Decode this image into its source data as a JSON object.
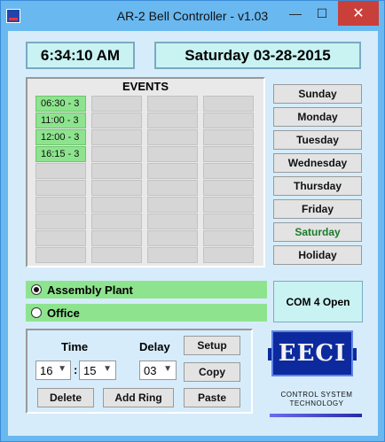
{
  "window": {
    "title": "AR-2 Bell Controller - v1.03",
    "minimize": "—",
    "maximize": "☐",
    "close": "✕"
  },
  "clock": {
    "time": "6:34:10 AM",
    "date": "Saturday 03-28-2015"
  },
  "events": {
    "label": "EVENTS",
    "columns": [
      [
        "06:30 - 3",
        "11:00 - 3",
        "12:00 - 3",
        "16:15 - 3",
        "",
        "",
        "",
        "",
        "",
        ""
      ],
      [
        "",
        "",
        "",
        "",
        "",
        "",
        "",
        "",
        "",
        ""
      ],
      [
        "",
        "",
        "",
        "",
        "",
        "",
        "",
        "",
        "",
        ""
      ],
      [
        "",
        "",
        "",
        "",
        "",
        "",
        "",
        "",
        "",
        ""
      ]
    ]
  },
  "days": [
    "Sunday",
    "Monday",
    "Tuesday",
    "Wednesday",
    "Thursday",
    "Friday",
    "Saturday",
    "Holiday"
  ],
  "active_day": "Saturday",
  "groups": [
    {
      "label": "Assembly Plant",
      "selected": true
    },
    {
      "label": "Office",
      "selected": false
    }
  ],
  "com_status": "COM 4 Open",
  "controls": {
    "time_label": "Time",
    "delay_label": "Delay",
    "hour": "16",
    "separator": ":",
    "minute": "15",
    "delay": "03",
    "setup": "Setup",
    "copy": "Copy",
    "paste": "Paste",
    "delete": "Delete",
    "add_ring": "Add Ring"
  },
  "logo": {
    "mark": "EECI",
    "line1": "CONTROL SYSTEM",
    "line2": "TECHNOLOGY"
  },
  "colors": {
    "window_border": "#6ab8f0",
    "client": "#d6ecfa",
    "event_on": "#8ee48e",
    "active_day": "#1b7b2a",
    "logo": "#0c2a9e"
  }
}
